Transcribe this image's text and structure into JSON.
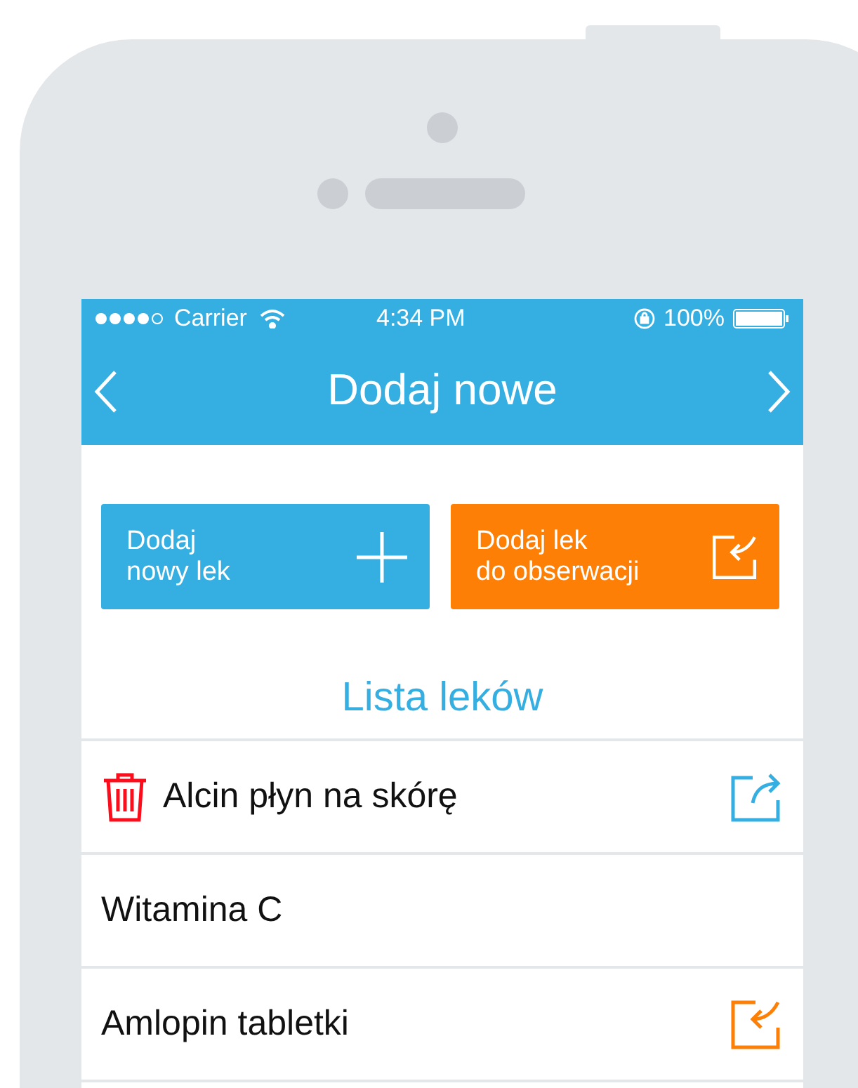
{
  "status_bar": {
    "carrier": "Carrier",
    "time": "4:34 PM",
    "battery": "100%"
  },
  "nav": {
    "title": "Dodaj nowe"
  },
  "actions": [
    {
      "kind": "add",
      "line1": "Dodaj",
      "line2": "nowy lek"
    },
    {
      "kind": "observe",
      "line1": "Dodaj lek",
      "line2": "do obserwacji"
    }
  ],
  "list": {
    "title": "Lista leków",
    "items": [
      {
        "name": "Alcin płyn na skórę",
        "deletable": true,
        "kind": "share"
      },
      {
        "name": "Witamina C",
        "deletable": false,
        "kind": "plain"
      },
      {
        "name": "Amlopin tabletki",
        "deletable": false,
        "kind": "import"
      }
    ]
  }
}
